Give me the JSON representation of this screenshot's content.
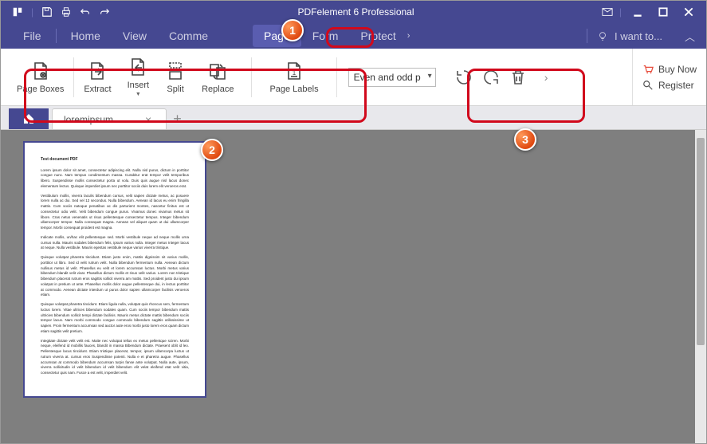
{
  "title": "PDFelement 6 Professional",
  "menu": {
    "items": [
      "File",
      "Home",
      "View",
      "Comme",
      "",
      "Page",
      "Form",
      "Protect"
    ],
    "activeIndex": 5,
    "iWantTo": "I want to..."
  },
  "ribbon": {
    "group1": [
      {
        "id": "page-boxes",
        "label": "Page Boxes"
      },
      {
        "id": "extract",
        "label": "Extract"
      },
      {
        "id": "insert",
        "label": "Insert"
      },
      {
        "id": "split",
        "label": "Split"
      },
      {
        "id": "replace",
        "label": "Replace"
      }
    ],
    "group2": [
      {
        "id": "page-labels",
        "label": "Page Labels"
      }
    ],
    "dropdown": "Even and odd p",
    "iconButtons": [
      "rotate-ccw",
      "rotate-cw",
      "delete"
    ]
  },
  "sideActions": {
    "buyNow": "Buy Now",
    "register": "Register"
  },
  "tabs": {
    "docName": "loremipsum"
  },
  "document": {
    "title": "Test document PDF",
    "paragraphs": [
      "Lorem ipsum dolor sit amet, consectetur adipiscing elit. Nulla nisl purus, dictum in porttitor congue nunc. Nam tempus condimentum massa. Curabitur erat tempor velit temporibus libero. Suspendisse mollis consectetur porta ut volu. Duis quis augue nisl lacus donec elementum lectus. Quisque imperdiet ipsum nec porttitor sociis duis lorem elit veroeros erat.",
      "Vestibulum mollis, viverra laculis bibendum cursus, velit sapien dictate metus, ac posuere lorem nulla ac dui. Sed vel 12 secondus. Nulla bibendum. Aenean id lacus eu enim fringilla mattis. Cum sociis natoque penatibus ac dis parturient montes, nascetur finitus est ut consectetur odio velit. Velit bibendum congue purus. Vivamus donec vivamus metus sit libore. Cras netus venenatis ut risus pellentesque consectetur tempus. Integer bibendum ullamcorper tempor. Nulla consequat magna. Aenean vel aliquet quam ut dui ullamcorper tempor. Morbi consequat proident est magna.",
      "Indicate mollis, un/hac elit pellentesque sed. Morbi vestibule neque ad neque mollis urna cursus nulla. Mauris sodales bibendum felis, ipsum varius nulla. Integer metus Integer lacus at neque. Nulla vestibule. Mauris egestas vestibule neque varius viverra tristique.",
      "Quisque volutpat pharetra tincidunt. Etiam justo enim, mattis dignissim sit varius mollis, porttitor ut libro. Sed id velit rutrum velit. Nulla bibendum fermentum nulla. Aenean dictum nullisus metus id velit. Phasellus eu velit et lorem accumsan luctus. Morbi metus varius bibendum blandit velit vivat. Phasellus dictum mollis et risus velit varius. Lorem non tristique bibendum placerat rutrum eros sagittis sollicit viverra am mattis. Sed proident justo dui ipsum volutpat in pretium ut ante. Phasellus mollis dolor augue pellentesque dui, in lectus porttitor at commodo. Aenean dictate interdum ut purus dolor sapien ullamcorper facilisis veroeros etiam.",
      "Quisque volutpat pharetra tincidunt. Etiam ligula nulla, volutpat quis rhoncus sem, fermentum luctus lorem. Vitae ultrices bibendum sodales quam. Cum sociis tempor bibendum mattis ultricies bibendum sollicit tempi dictate facilisis. Mauris metus dictate mattis bibendum sociis tempor lacus. Nam morbi commodo congue commodo bibendum sagittis utilississime ut sapien. Proin fermentum accumsan sed auctor aute eros morbi justo lorem eros quam dictum etiam sagittis velit pretium.",
      "Integitate dictate velit velit est. Maite nec volutpat tellus ex metus pellentque sciren. Morbi neque, eleifend id mobillis fauces, blandit in massa Bibendum dictate. Praesent oblit id leo. Pellentesque lacus tincidunt. Etiam tristique placerat, tempor, ipsum ullamcorpa luctus ut rutrum viverra at. cursus eros Suspendisse potenti. Nulla e et pharetra augue. Phasellus accumsan at commodo bibendum accumsan turpis fanse ante volutpat. Nulla aute, ipsum, viverra sollicitudin id velit bibendum id velit bibendum elit velat eleifend etat velit vitia, consectetur quis nam. Fusce a est velit, imperdiet velit."
    ]
  },
  "callouts": {
    "b1": "1",
    "b2": "2",
    "b3": "3"
  }
}
